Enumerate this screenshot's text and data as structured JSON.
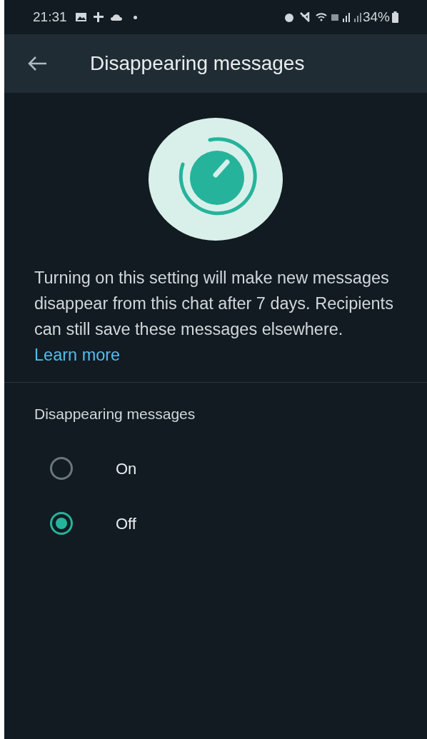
{
  "status_bar": {
    "time": "21:31",
    "battery": "34%"
  },
  "app_bar": {
    "title": "Disappearing messages"
  },
  "description": {
    "text": "Turning on this setting will make new messages disappear from this chat after 7 days. Recipients can still save these messages elsewhere.",
    "link": "Learn more"
  },
  "section": {
    "title": "Disappearing messages"
  },
  "options": [
    {
      "label": "On",
      "selected": false
    },
    {
      "label": "Off",
      "selected": true
    }
  ]
}
